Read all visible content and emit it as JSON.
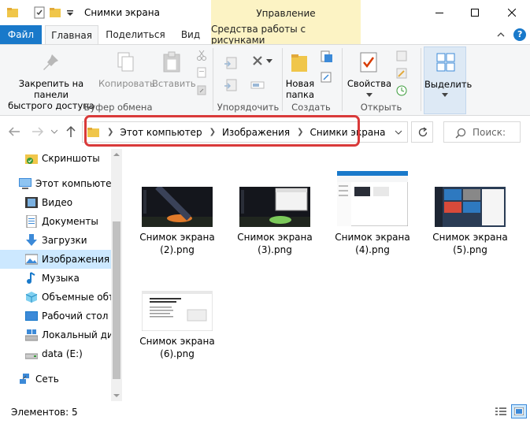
{
  "window": {
    "title": "Снимки экрана",
    "contextual_tab": "Управление"
  },
  "ribbon_tabs": {
    "file": "Файл",
    "home": "Главная",
    "share": "Поделиться",
    "view": "Вид",
    "picture_tools": "Средства работы с рисунками"
  },
  "ribbon": {
    "pin_line1": "Закрепить на панели",
    "pin_line2": "быстрого доступа",
    "copy": "Копировать",
    "paste": "Вставить",
    "group_clipboard": "Буфер обмена",
    "group_organize": "Упорядочить",
    "new_folder_line1": "Новая",
    "new_folder_line2": "папка",
    "group_new": "Создать",
    "properties": "Свойства",
    "group_open": "Открыть",
    "select": "Выделить"
  },
  "address": {
    "crumbs": [
      "Этот компьютер",
      "Изображения",
      "Снимки экрана"
    ],
    "search_placeholder": "Поиск: "
  },
  "nav": {
    "items": [
      {
        "label": "Скриншоты",
        "icon": "folder-check-icon"
      },
      {
        "label": "Этот компьютер",
        "icon": "computer-icon"
      },
      {
        "label": "Видео",
        "icon": "video-icon"
      },
      {
        "label": "Документы",
        "icon": "documents-icon"
      },
      {
        "label": "Загрузки",
        "icon": "downloads-icon"
      },
      {
        "label": "Изображения",
        "icon": "pictures-icon",
        "selected": true
      },
      {
        "label": "Музыка",
        "icon": "music-icon"
      },
      {
        "label": "Объемные объ",
        "icon": "3d-objects-icon"
      },
      {
        "label": "Рабочий стол",
        "icon": "desktop-icon"
      },
      {
        "label": "Локальный дис",
        "icon": "local-disk-icon"
      },
      {
        "label": "data (E:)",
        "icon": "drive-icon"
      },
      {
        "label": "Сеть",
        "icon": "network-icon"
      }
    ]
  },
  "files": [
    {
      "line1": "Снимок экрана",
      "line2": "(2).png",
      "thumbnail": "dark-landscape"
    },
    {
      "line1": "Снимок экрана",
      "line2": "(3).png",
      "thumbnail": "dark-landscape-window"
    },
    {
      "line1": "Снимок экрана",
      "line2": "(4).png",
      "thumbnail": "explorer-window"
    },
    {
      "line1": "Снимок экрана",
      "line2": "(5).png",
      "thumbnail": "start-menu"
    },
    {
      "line1": "Снимок экрана",
      "line2": "(6).png",
      "thumbnail": "web-page"
    }
  ],
  "status": {
    "items_count": "Элементов: 5"
  },
  "colors": {
    "accent": "#1979ca",
    "contextual": "#fcf3c4",
    "selection": "#cce8ff",
    "highlight": "#d93a3a"
  }
}
